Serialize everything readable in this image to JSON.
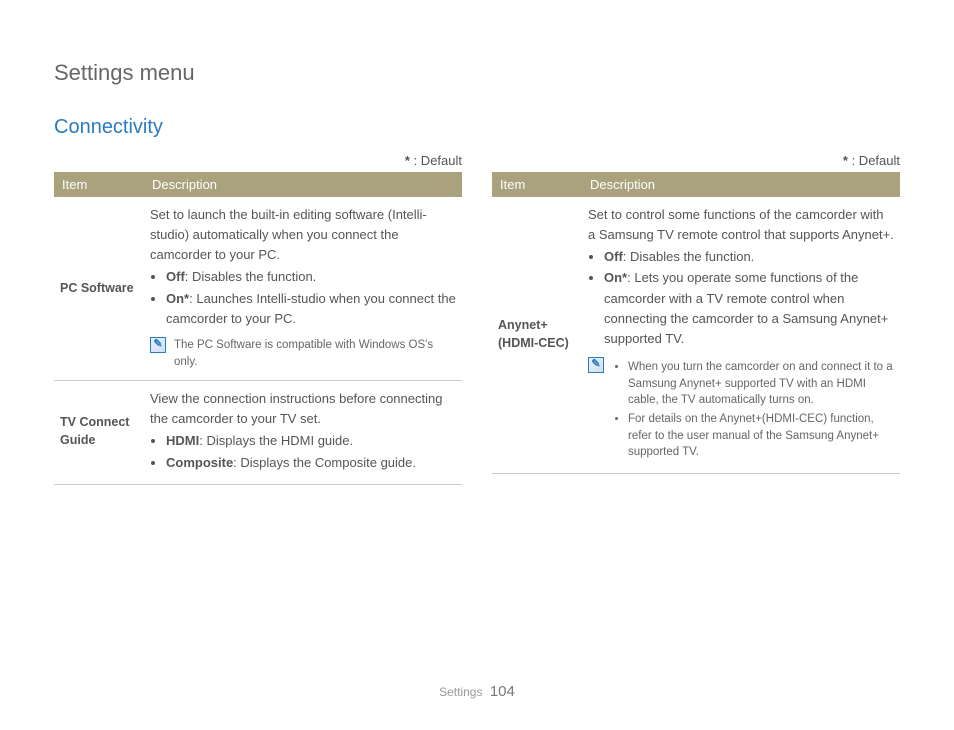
{
  "page_title": "Settings menu",
  "section_title": "Connectivity",
  "default_marker": "*",
  "default_label": " : Default",
  "headers": {
    "item": "Item",
    "desc": "Description"
  },
  "left": {
    "rows": [
      {
        "item": "PC Software",
        "intro": "Set to launch the built-in editing software (Intelli-studio) automatically when you connect the camcorder to your PC.",
        "opts": [
          {
            "b": "Off",
            "t": ": Disables the function."
          },
          {
            "b": "On*",
            "t": ": Launches Intelli-studio when you connect the camcorder to your PC."
          }
        ],
        "note_plain": "The PC Software is compatible with Windows OS's only."
      },
      {
        "item": "TV Connect Guide",
        "intro": "View the connection instructions before connecting the camcorder to your TV set.",
        "opts": [
          {
            "b": "HDMI",
            "t": ": Displays the HDMI guide."
          },
          {
            "b": "Composite",
            "t": ": Displays the Composite guide."
          }
        ]
      }
    ]
  },
  "right": {
    "rows": [
      {
        "item": "Anynet+ (HDMI-CEC)",
        "intro": "Set to control some functions of the camcorder with a Samsung TV remote control that supports Anynet+.",
        "opts": [
          {
            "b": "Off",
            "t": ": Disables the function."
          },
          {
            "b": "On*",
            "t": ": Lets you operate some functions of the camcorder with a TV remote control when connecting the camcorder to a Samsung Anynet+ supported TV."
          }
        ],
        "note_list": [
          "When you turn the camcorder on and connect it to a Samsung Anynet+ supported TV with an HDMI cable, the TV automatically turns on.",
          "For details on the Anynet+(HDMI-CEC) function, refer to the user manual of the Samsung Anynet+ supported TV."
        ]
      }
    ]
  },
  "footer": {
    "section": "Settings",
    "page": "104"
  },
  "note_icon_glyph": "✎"
}
